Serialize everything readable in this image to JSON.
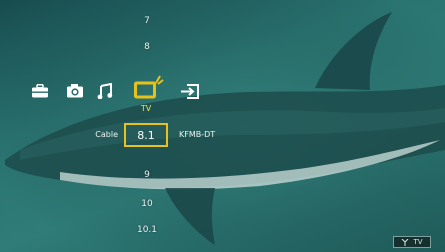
{
  "menu": {
    "icons": [
      {
        "name": "toolbox-icon"
      },
      {
        "name": "camera-icon"
      },
      {
        "name": "music-note-icon"
      },
      {
        "name": "tv-icon",
        "selected": true
      },
      {
        "name": "input-icon"
      }
    ],
    "selected_label": "TV",
    "accent_color": "#e7c21a"
  },
  "channels": {
    "above": [
      "7",
      "8"
    ],
    "source_label": "Cable",
    "current": "8.1",
    "station": "KFMB-DT",
    "below": [
      "9",
      "10",
      "10.1"
    ]
  },
  "status_badge": {
    "icon": "antenna-icon",
    "label": "TV"
  }
}
